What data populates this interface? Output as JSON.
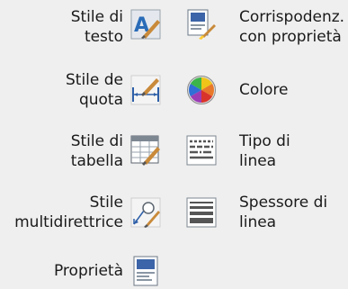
{
  "panel": {
    "items": [
      {
        "line1": "Stile di",
        "line2": "testo",
        "icon": "text-style-icon"
      },
      {
        "line1": "Corrispodenz.",
        "line2": "con proprietà",
        "icon": "match-properties-icon"
      },
      {
        "line1": "Stile de",
        "line2": "quota",
        "icon": "dimension-style-icon"
      },
      {
        "line1": "Colore",
        "line2": "",
        "icon": "color-wheel-icon"
      },
      {
        "line1": "Stile di",
        "line2": "tabella",
        "icon": "table-style-icon"
      },
      {
        "line1": "Tipo di",
        "line2": "linea",
        "icon": "linetype-icon"
      },
      {
        "line1": "Stile",
        "line2": "multidirettrice",
        "icon": "multileader-style-icon"
      },
      {
        "line1": "Spessore di",
        "line2": "linea",
        "icon": "lineweight-icon"
      },
      {
        "line1": "Proprietà",
        "line2": "",
        "icon": "properties-icon"
      }
    ]
  }
}
